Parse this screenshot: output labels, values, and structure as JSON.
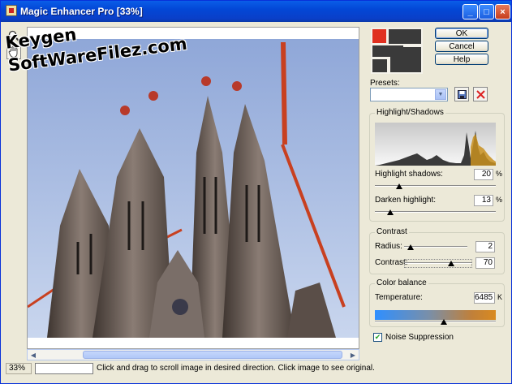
{
  "window": {
    "title": "Magic Enhancer Pro [33%]",
    "minimize_label": "_",
    "maximize_label": "□",
    "close_label": "×"
  },
  "toolbar": {
    "tools": [
      {
        "name": "zoom",
        "icon": "magnifier-icon"
      },
      {
        "name": "pan",
        "icon": "hand-icon"
      }
    ]
  },
  "watermark": {
    "line1": "Keygen",
    "line2": "SoftWareFilez.com"
  },
  "buttons": {
    "ok": "OK",
    "cancel": "Cancel",
    "help": "Help"
  },
  "presets": {
    "label": "Presets:",
    "value": ""
  },
  "highlight_shadows": {
    "title": "Highlight/Shadows",
    "highlight_shadows_label": "Highlight shadows:",
    "highlight_shadows_value": "20",
    "highlight_shadows_fraction": 0.2,
    "darken_highlight_label": "Darken highlight:",
    "darken_highlight_value": "13",
    "darken_highlight_fraction": 0.13,
    "unit": "%"
  },
  "contrast": {
    "title": "Contrast",
    "radius_label": "Radius:",
    "radius_value": "2",
    "radius_fraction": 0.1,
    "contrast_label": "Contrast:",
    "contrast_value": "70",
    "contrast_fraction": 0.7
  },
  "color_balance": {
    "title": "Color balance",
    "temperature_label": "Temperature:",
    "temperature_value": "6485",
    "temperature_unit": "K",
    "temperature_fraction": 0.57,
    "colors": {
      "cool": "#2f8fff",
      "warm": "#d98a20"
    }
  },
  "noise_suppression": {
    "label": "Noise Suppression",
    "checked": true
  },
  "status": {
    "zoom": "33%",
    "message": "Click and drag to scroll image in desired direction. Click image to see original."
  }
}
